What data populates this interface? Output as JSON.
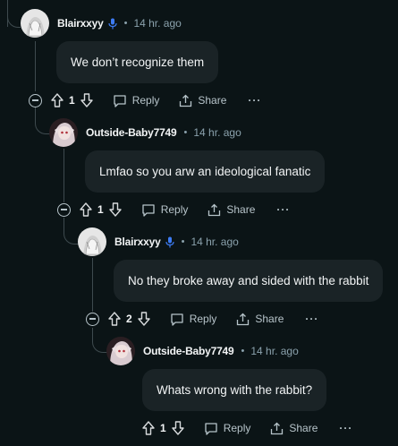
{
  "comments": [
    {
      "username": "Blairxxyy",
      "verified_icon": "microphone-icon",
      "time": "14 hr. ago",
      "text": "We don’t recognize them",
      "score": "1",
      "reply": "Reply",
      "share": "Share",
      "more": "···"
    },
    {
      "username": "Outside-Baby7749",
      "time": "14 hr. ago",
      "text": "Lmfao so you arw an ideological fanatic",
      "score": "1",
      "reply": "Reply",
      "share": "Share",
      "more": "···"
    },
    {
      "username": "Blairxxyy",
      "verified_icon": "microphone-icon",
      "time": "14 hr. ago",
      "text": "No they broke away and sided with the rabbit",
      "score": "2",
      "reply": "Reply",
      "share": "Share",
      "more": "···"
    },
    {
      "username": "Outside-Baby7749",
      "time": "14 hr. ago",
      "text": "Whats wrong with the rabbit?",
      "score": "1",
      "reply": "Reply",
      "share": "Share",
      "more": "···"
    }
  ],
  "separator": "•",
  "colors": {
    "background": "#0b1416",
    "bubble": "#1a2326",
    "accent_mic": "#3d7cf5",
    "meta": "#8ba2ad"
  }
}
